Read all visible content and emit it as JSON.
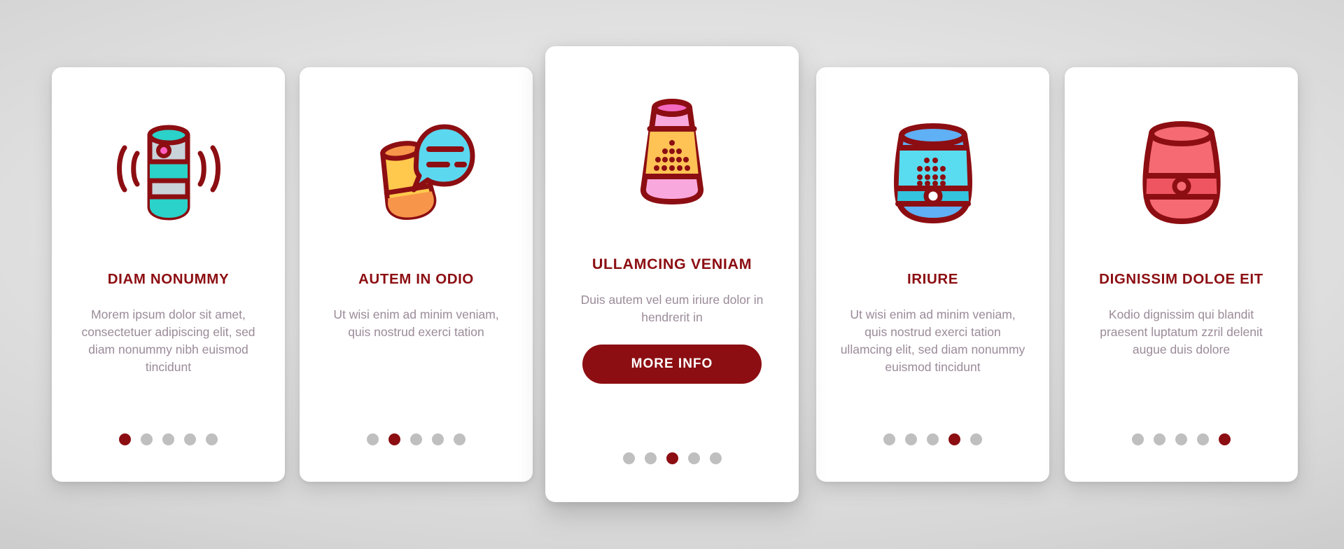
{
  "theme": {
    "accent": "#8C0E12",
    "body_text": "#9b8b99",
    "card_bg": "#ffffff",
    "dot_inactive": "#bfbfbf",
    "background": "#d9d9d9"
  },
  "cards": [
    {
      "icon_name": "smart-speaker-cylinder-sound-waves-icon",
      "title": "DIAM NONUMMY",
      "body": "Morem ipsum dolor sit amet, consectetuer adipiscing elit, sed diam nonummy nibh euismod tincidunt",
      "dots": {
        "count": 5,
        "active_index": 0
      },
      "featured": false
    },
    {
      "icon_name": "smart-speaker-voice-chat-bubble-icon",
      "title": "AUTEM IN ODIO",
      "body": "Ut wisi enim ad minim veniam, quis nostrud exerci tation",
      "dots": {
        "count": 5,
        "active_index": 1
      },
      "featured": false
    },
    {
      "icon_name": "smart-speaker-tapered-speaker-grille-icon",
      "title": "ULLAMCING VENIAM",
      "body": "Duis autem vel eum iriure dolor in hendrerit in",
      "button_label": "MORE INFO",
      "dots": {
        "count": 5,
        "active_index": 2
      },
      "featured": true
    },
    {
      "icon_name": "smart-speaker-rounded-blue-grille-icon",
      "title": "IRIURE",
      "body": "Ut wisi enim ad minim veniam, quis nostrud exerci tation ullamcing elit, sed diam nonummy euismod tincidunt",
      "dots": {
        "count": 5,
        "active_index": 3
      },
      "featured": false
    },
    {
      "icon_name": "smart-speaker-rounded-red-icon",
      "title": "DIGNISSIM DOLOE EIT",
      "body": "Kodio dignissim qui blandit praesent luptatum zzril delenit augue duis dolore",
      "dots": {
        "count": 5,
        "active_index": 4
      },
      "featured": false
    }
  ]
}
